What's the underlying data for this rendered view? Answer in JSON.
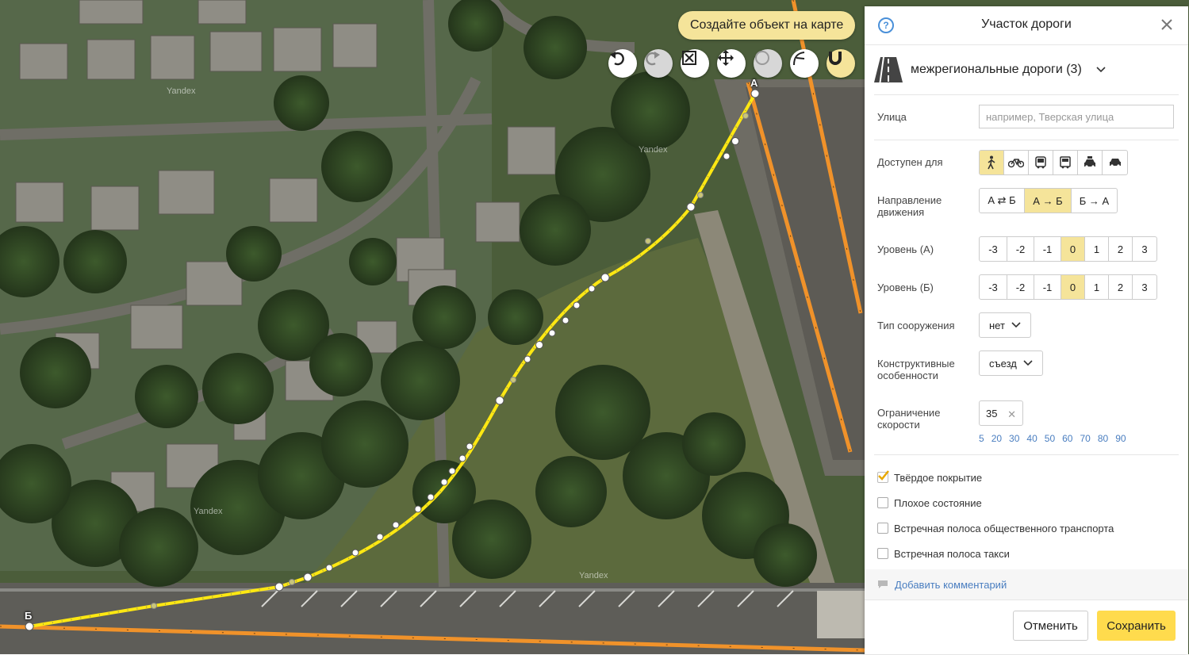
{
  "map": {
    "watermarks": [
      "Yandex",
      "Yandex",
      "Yandex",
      "Yandex"
    ],
    "point_a_label": "А",
    "point_b_label": "Б",
    "hint": "Создайте объект на карте",
    "tools": [
      {
        "name": "undo",
        "icon": "undo-icon",
        "state": "enabled"
      },
      {
        "name": "redo",
        "icon": "redo-icon",
        "state": "disabled"
      },
      {
        "name": "delete",
        "icon": "delete-icon",
        "state": "enabled"
      },
      {
        "name": "move",
        "icon": "move-icon",
        "state": "enabled"
      },
      {
        "name": "circle",
        "icon": "circle-icon",
        "state": "disabled"
      },
      {
        "name": "split",
        "icon": "split-icon",
        "state": "enabled"
      },
      {
        "name": "snap",
        "icon": "magnet-icon",
        "state": "active"
      }
    ]
  },
  "panel": {
    "title": "Участок дороги",
    "road_type": "межрегиональные дороги (3)",
    "street": {
      "label": "Улица",
      "value": "",
      "placeholder": "например, Тверская улица"
    },
    "access": {
      "label": "Доступен для",
      "modes": [
        "pedestrian-icon",
        "bicycle-icon",
        "bus-icon",
        "truck-icon",
        "taxi-icon",
        "car-icon"
      ],
      "selected": [
        "pedestrian-icon"
      ]
    },
    "direction": {
      "label": "Направление движения",
      "options": [
        "А ⇄ Б",
        "А → Б",
        "Б → А"
      ],
      "selected": "А → Б"
    },
    "level_a": {
      "label": "Уровень (А)",
      "options": [
        "-3",
        "-2",
        "-1",
        "0",
        "1",
        "2",
        "3"
      ],
      "selected": "0"
    },
    "level_b": {
      "label": "Уровень (Б)",
      "options": [
        "-3",
        "-2",
        "-1",
        "0",
        "1",
        "2",
        "3"
      ],
      "selected": "0"
    },
    "structure": {
      "label": "Тип сооружения",
      "value": "нет"
    },
    "features": {
      "label": "Конструктивные особенности",
      "value": "съезд"
    },
    "speed": {
      "label": "Ограничение скорости",
      "value": "35",
      "clear": "✕",
      "presets": [
        "5",
        "20",
        "30",
        "40",
        "50",
        "60",
        "70",
        "80",
        "90"
      ]
    },
    "checkboxes": [
      {
        "label": "Твёрдое покрытие",
        "checked": true
      },
      {
        "label": "Плохое состояние",
        "checked": false
      },
      {
        "label": "Встречная полоса общественного транспорта",
        "checked": false
      },
      {
        "label": "Встречная полоса такси",
        "checked": false
      }
    ],
    "comment_link": "Добавить комментарий",
    "cancel": "Отменить",
    "save": "Сохранить"
  },
  "colors": {
    "accent_yellow": "#ffdb4d",
    "selected_bg": "#f5e49a",
    "road_orange": "#f0922a",
    "link_blue": "#4a7ec0"
  }
}
